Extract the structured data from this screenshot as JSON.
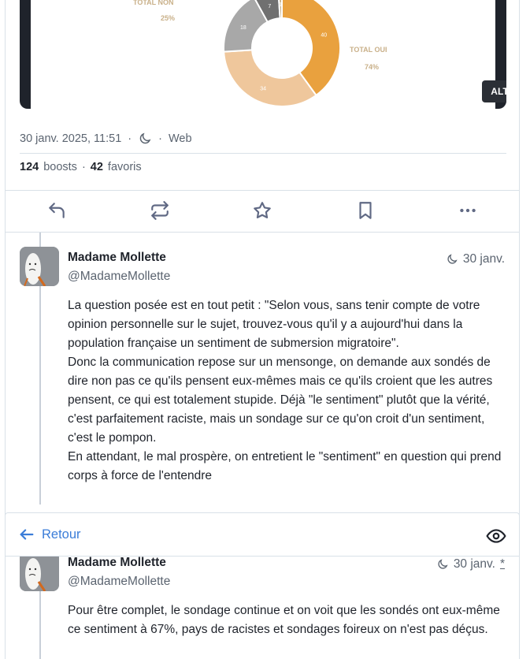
{
  "post": {
    "media": {
      "alt_badge": "ALT",
      "chart_labels": {
        "total_non": "TOTAL NON",
        "total_non_pct": "25%",
        "total_oui": "TOTAL OUI",
        "total_oui_pct": "74%"
      }
    },
    "meta": {
      "date": "30 janv. 2025, 11:51",
      "sep1": "·",
      "sep2": "·",
      "visibility_icon": "moon-icon",
      "app": "Web"
    },
    "counts": {
      "boosts": "124",
      "boosts_label": "boosts",
      "sep": "·",
      "favs": "42",
      "favs_label": "favoris"
    },
    "actions": [
      "reply-icon",
      "boost-icon",
      "star-icon",
      "bookmark-icon",
      "more-icon"
    ]
  },
  "chart_data": {
    "type": "pie",
    "categories": [
      "",
      "",
      "",
      "",
      ""
    ],
    "values": [
      40,
      34,
      18,
      7,
      1
    ],
    "labels": [
      "40",
      "34",
      "18",
      "7",
      "1"
    ],
    "colors": [
      "#e9a13e",
      "#efc79c",
      "#a8a8a8",
      "#707070",
      "#c8b08a"
    ]
  },
  "reply1": {
    "author": "Madame Mollette",
    "handle": "@MadameMollette",
    "date": "30 janv.",
    "paragraphs": [
      "La question posée est en tout petit : \"Selon vous, sans tenir compte de votre opinion personnelle sur le sujet, trouvez-vous qu'il y a aujourd'hui dans la population française un sentiment de submersion migratoire\".",
      "Donc la communication repose sur un mensonge, on demande aux sondés de dire non pas ce qu'ils pensent eux-mêmes mais ce qu'ils croient que les autres pensent, ce qui est totalement stupide. Déjà \"le sentiment\" plutôt que la vérité, c'est parfaitement raciste, mais un sondage sur ce qu'on croit d'un sentiment, c'est le pompon.",
      "En attendant,  le mal prospère, on entretient le \"sentiment\" en question qui prend corps à force de l'entendre"
    ]
  },
  "backbar": {
    "label": "Retour"
  },
  "reply2": {
    "author": "Madame Mollette",
    "handle": "@MadameMollette",
    "date": "30 janv.",
    "edited_mark": "*",
    "text": "Pour être complet, le sondage continue et on voit que les sondés ont eux-même ce sentiment à 67%, pays de racistes et sondages foireux on n'est pas déçus."
  }
}
